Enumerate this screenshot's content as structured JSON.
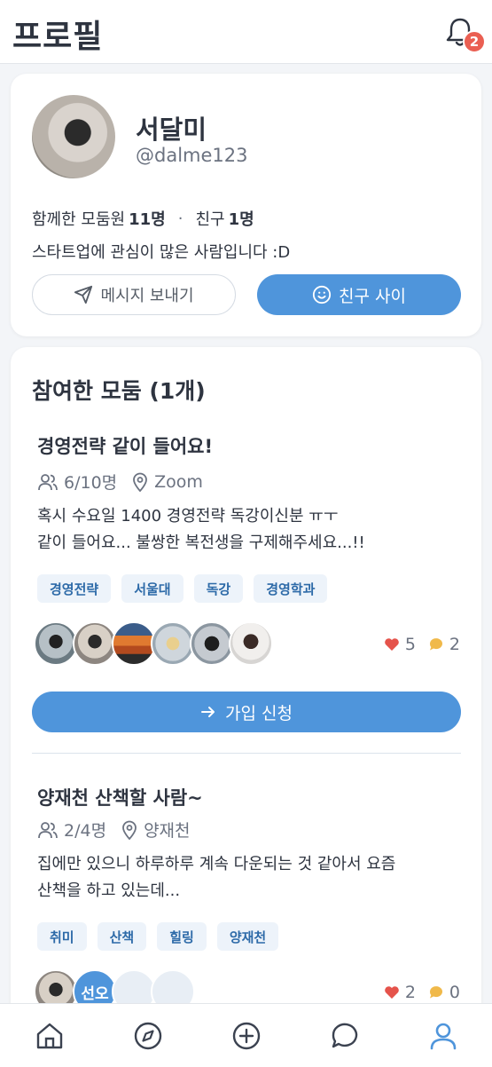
{
  "header": {
    "title": "프로필",
    "notification_count": "2"
  },
  "profile": {
    "name": "서달미",
    "handle": "@dalme123",
    "stats_prefix": "함께한 모둠원",
    "members_count": "11명",
    "friends_label": "친구",
    "friends_count": "1명",
    "bio": "스타트업에 관심이 많은 사람입니다 :D",
    "message_button": "메시지 보내기",
    "friend_button": "친구 사이"
  },
  "groups": {
    "section_title": "참여한 모둠 (1개)",
    "items": [
      {
        "title": "경영전략 같이 들어요!",
        "capacity": "6/10명",
        "location": "Zoom",
        "desc_line1": "혹시 수요일 1400 경영전략 독강이신분 ㅠㅜ",
        "desc_line2": "같이 들어요... 불쌍한 복전생을 구제해주세요...!!",
        "tags": [
          "경영전략",
          "서울대",
          "독강",
          "경영학과"
        ],
        "likes": "5",
        "comments": "2",
        "join_button": "가입 신청"
      },
      {
        "title": "양재천 산책할 사람~",
        "capacity": "2/4명",
        "location": "양재천",
        "desc_line1": "집에만 있으니 하루하루 계속 다운되는 것 같아서 요즘",
        "desc_line2": "산책을 하고 있는데...",
        "tags": [
          "취미",
          "산책",
          "힐링",
          "양재천"
        ],
        "avatar_text": "선오",
        "likes": "2",
        "comments": "0"
      }
    ]
  },
  "tabbar": {
    "items": [
      "home-icon",
      "explore-icon",
      "add-icon",
      "chat-icon",
      "profile-icon"
    ],
    "active": "profile-icon"
  },
  "colors": {
    "accent": "#4f95db",
    "badge": "#ea5f52",
    "heart": "#e5534b",
    "comment": "#f0b94a"
  }
}
